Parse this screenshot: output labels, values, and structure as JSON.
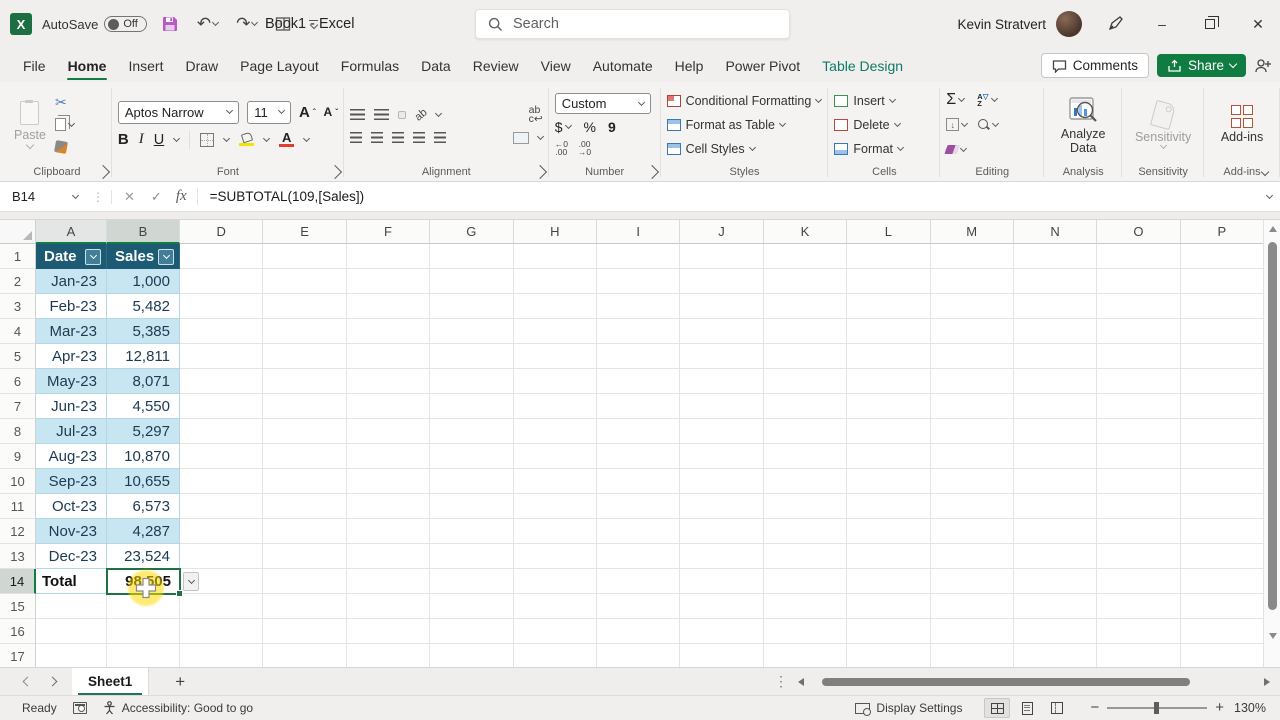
{
  "titlebar": {
    "autosave_label": "AutoSave",
    "autosave_state": "Off",
    "title": "Book1 - Excel",
    "search_placeholder": "Search",
    "user_name": "Kevin Stratvert"
  },
  "tabs": {
    "items": [
      "File",
      "Home",
      "Insert",
      "Draw",
      "Page Layout",
      "Formulas",
      "Data",
      "Review",
      "View",
      "Automate",
      "Help",
      "Power Pivot",
      "Table Design"
    ],
    "active": "Home",
    "contextual": "Table Design",
    "comments_label": "Comments",
    "share_label": "Share"
  },
  "ribbon": {
    "clipboard": {
      "label": "Clipboard",
      "paste": "Paste"
    },
    "font": {
      "label": "Font",
      "font_name": "Aptos Narrow",
      "font_size": "11"
    },
    "alignment": {
      "label": "Alignment"
    },
    "number": {
      "label": "Number",
      "format": "Custom"
    },
    "styles": {
      "label": "Styles",
      "items": [
        "Conditional Formatting",
        "Format as Table",
        "Cell Styles"
      ]
    },
    "cells": {
      "label": "Cells",
      "items": [
        "Insert",
        "Delete",
        "Format"
      ]
    },
    "editing": {
      "label": "Editing"
    },
    "analysis": {
      "label": "Analysis",
      "button": "Analyze Data"
    },
    "sensitivity": {
      "label": "Sensitivity",
      "button": "Sensitivity"
    },
    "addins": {
      "label": "Add-ins",
      "button": "Add-ins"
    }
  },
  "formula_bar": {
    "name_box": "B14",
    "formula": "=SUBTOTAL(109,[Sales])"
  },
  "spreadsheet": {
    "columns": [
      "A",
      "B",
      "D",
      "E",
      "F",
      "G",
      "H",
      "I",
      "J",
      "K",
      "L",
      "M",
      "N",
      "O",
      "P"
    ],
    "highlighted_columns": [
      "A",
      "B"
    ],
    "active_cell": "B14",
    "active_row": 14,
    "row_count": 17,
    "table": {
      "headers": [
        "Date",
        "Sales"
      ],
      "rows": [
        [
          "Jan-23",
          "1,000"
        ],
        [
          "Feb-23",
          "5,482"
        ],
        [
          "Mar-23",
          "5,385"
        ],
        [
          "Apr-23",
          "12,811"
        ],
        [
          "May-23",
          "8,071"
        ],
        [
          "Jun-23",
          "4,550"
        ],
        [
          "Jul-23",
          "5,297"
        ],
        [
          "Aug-23",
          "10,870"
        ],
        [
          "Sep-23",
          "10,655"
        ],
        [
          "Oct-23",
          "6,573"
        ],
        [
          "Nov-23",
          "4,287"
        ],
        [
          "Dec-23",
          "23,524"
        ]
      ],
      "total_row": [
        "Total",
        "98,505"
      ]
    }
  },
  "sheet_bar": {
    "sheet_name": "Sheet1"
  },
  "status_bar": {
    "mode": "Ready",
    "accessibility": "Accessibility: Good to go",
    "display_settings": "Display Settings",
    "zoom_level": "130%"
  },
  "glyphs": {
    "undo": "↶",
    "redo": "↷",
    "sigma": "Σ",
    "dollar": "$",
    "percent": "%",
    "comma": "9",
    "bold": "B",
    "italic": "I",
    "underline": "U",
    "close": "✕",
    "check": "✓",
    "fx": "fx",
    "dots": "⋮",
    "plus": "+",
    "minus": "−"
  },
  "colors": {
    "accent_green": "#107C41",
    "selection_green": "#1E7145",
    "table_header": "#1d5a73",
    "band_blue": "#c8e6f2",
    "contextual_tab": "#0E7A66",
    "fill_yellow": "#f3e500",
    "font_red": "#e03c32"
  }
}
